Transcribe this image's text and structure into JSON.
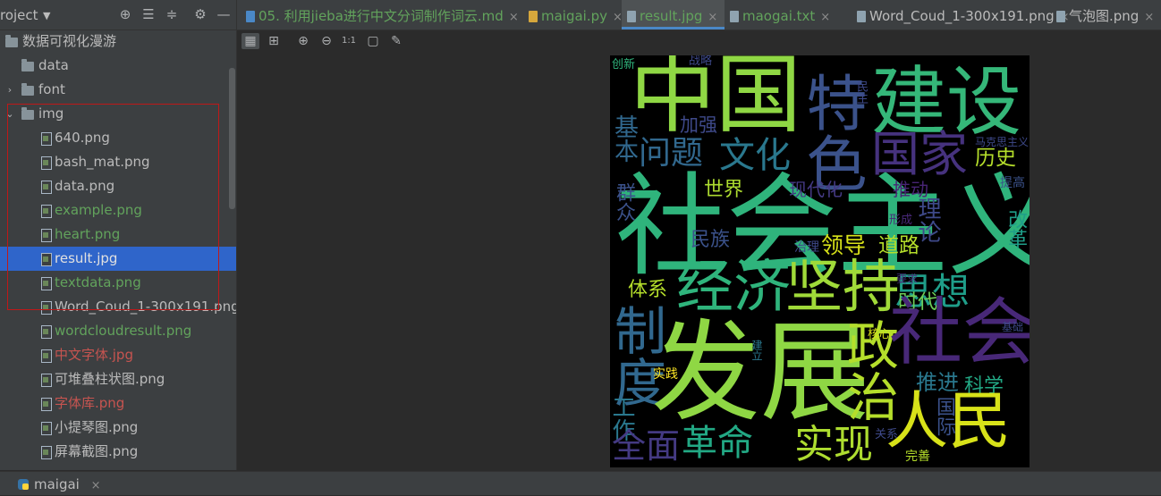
{
  "project": {
    "title": "roject",
    "header_icons": [
      "locate-icon",
      "collapse-all-icon",
      "expand-all-icon",
      "gear-icon",
      "hide-icon"
    ],
    "tree": [
      {
        "label": "数据可视化漫游",
        "type": "folder",
        "depth": 0,
        "arrow": "",
        "color": "default"
      },
      {
        "label": "data",
        "type": "folder",
        "depth": 1,
        "arrow": "",
        "color": "default"
      },
      {
        "label": "font",
        "type": "folder",
        "depth": 1,
        "arrow": "›",
        "color": "default"
      },
      {
        "label": "img",
        "type": "folder",
        "depth": 1,
        "arrow": "⌄",
        "color": "default"
      },
      {
        "label": "640.png",
        "type": "file",
        "depth": 2,
        "color": "default"
      },
      {
        "label": "bash_mat.png",
        "type": "file",
        "depth": 2,
        "color": "default"
      },
      {
        "label": "data.png",
        "type": "file",
        "depth": 2,
        "color": "default"
      },
      {
        "label": "example.png",
        "type": "file",
        "depth": 2,
        "color": "green"
      },
      {
        "label": "heart.png",
        "type": "file",
        "depth": 2,
        "color": "green"
      },
      {
        "label": "result.jpg",
        "type": "file",
        "depth": 2,
        "color": "white",
        "selected": true
      },
      {
        "label": "textdata.png",
        "type": "file",
        "depth": 2,
        "color": "green"
      },
      {
        "label": "Word_Coud_1-300x191.png",
        "type": "file",
        "depth": 2,
        "color": "default"
      },
      {
        "label": "wordcloudresult.png",
        "type": "file",
        "depth": 2,
        "color": "green"
      },
      {
        "label": "中文字体.jpg",
        "type": "file",
        "depth": 2,
        "color": "red"
      },
      {
        "label": "可堆叠柱状图.png",
        "type": "file",
        "depth": 2,
        "color": "default"
      },
      {
        "label": "字体库.png",
        "type": "file",
        "depth": 2,
        "color": "red"
      },
      {
        "label": "小提琴图.png",
        "type": "file",
        "depth": 2,
        "color": "default"
      },
      {
        "label": "屏幕截图.png",
        "type": "file",
        "depth": 2,
        "color": "default"
      }
    ]
  },
  "tabs": [
    {
      "label": "05. 利用jieba进行中文分词制作词云.md",
      "color": "#62a35c",
      "icon": "markdown-file-icon",
      "icon_color": "#4a88c7",
      "active": false
    },
    {
      "label": "maigai.py",
      "color": "#62a35c",
      "icon": "python-file-icon",
      "icon_color": "#d6a73c",
      "active": false
    },
    {
      "label": "result.jpg",
      "color": "#62a35c",
      "icon": "image-file-icon",
      "icon_color": "#8fa3b0",
      "active": true
    },
    {
      "label": "maogai.txt",
      "color": "#62a35c",
      "icon": "text-file-icon",
      "icon_color": "#8fa3b0",
      "active": false
    },
    {
      "label": "Word_Coud_1-300x191.png",
      "color": "#bbbbbb",
      "icon": "image-file-icon",
      "icon_color": "#8fa3b0",
      "active": false
    },
    {
      "label": "气泡图.png",
      "color": "#bbbbbb",
      "icon": "image-file-icon",
      "icon_color": "#8fa3b0",
      "active": false
    }
  ],
  "close_glyph": "×",
  "image_toolbar": {
    "buttons": [
      {
        "name": "chessboard-icon",
        "glyph": "▦",
        "on": true
      },
      {
        "name": "grid-icon",
        "glyph": "⊞",
        "on": false
      },
      {
        "name": "zoom-in-icon",
        "glyph": "⊕",
        "on": false
      },
      {
        "name": "zoom-out-icon",
        "glyph": "⊖",
        "on": false
      },
      {
        "name": "actual-size-icon",
        "glyph": "1:1",
        "on": false
      },
      {
        "name": "fit-icon",
        "glyph": "▢",
        "on": false
      },
      {
        "name": "color-picker-icon",
        "glyph": "✎",
        "on": false
      }
    ]
  },
  "wordcloud": {
    "words": [
      {
        "text": "中国",
        "color": "#8fd744",
        "v": false
      },
      {
        "text": "建设",
        "color": "#35b779",
        "v": false
      },
      {
        "text": "特色",
        "color": "#3b528b",
        "v": true
      },
      {
        "text": "社会主义",
        "color": "#2fb47c",
        "v": false
      },
      {
        "text": "国家",
        "color": "#46327e",
        "v": false
      },
      {
        "text": "问题",
        "color": "#31688e",
        "v": false
      },
      {
        "text": "文化",
        "color": "#2a788e",
        "v": false
      },
      {
        "text": "历史",
        "color": "#b5de2b",
        "v": false
      },
      {
        "text": "加强",
        "color": "#3e4989",
        "v": false
      },
      {
        "text": "基本",
        "color": "#31688e",
        "v": true
      },
      {
        "text": "群众",
        "color": "#3b528b",
        "v": true
      },
      {
        "text": "世界",
        "color": "#addc30",
        "v": false
      },
      {
        "text": "现代化",
        "color": "#443983",
        "v": false
      },
      {
        "text": "推动",
        "color": "#482475",
        "v": false
      },
      {
        "text": "理论",
        "color": "#3e4989",
        "v": true
      },
      {
        "text": "改革",
        "color": "#1f9e89",
        "v": true
      },
      {
        "text": "民族",
        "color": "#3b528b",
        "v": false
      },
      {
        "text": "领导",
        "color": "#d8e219",
        "v": false
      },
      {
        "text": "道路",
        "color": "#b5de2b",
        "v": false
      },
      {
        "text": "治理",
        "color": "#3e4989",
        "v": false
      },
      {
        "text": "形成",
        "color": "#482878",
        "v": false
      },
      {
        "text": "提高",
        "color": "#3b528b",
        "v": false
      },
      {
        "text": "体系",
        "color": "#b5de2b",
        "v": false
      },
      {
        "text": "经济",
        "color": "#2fb47c",
        "v": false
      },
      {
        "text": "坚持",
        "color": "#a0da39",
        "v": false
      },
      {
        "text": "思想",
        "color": "#1f9e89",
        "v": false
      },
      {
        "text": "时代",
        "color": "#6ece58",
        "v": false
      },
      {
        "text": "要求",
        "color": "#46337e",
        "v": false
      },
      {
        "text": "马克思主义",
        "color": "#3e4989",
        "v": false
      },
      {
        "text": "制度",
        "color": "#31688e",
        "v": true
      },
      {
        "text": "发展",
        "color": "#8fd744",
        "v": false
      },
      {
        "text": "政治",
        "color": "#b5de2b",
        "v": true
      },
      {
        "text": "社会",
        "color": "#482878",
        "v": false
      },
      {
        "text": "基础",
        "color": "#3e4989",
        "v": false
      },
      {
        "text": "核心",
        "color": "#d8e219",
        "v": false
      },
      {
        "text": "建立",
        "color": "#2a788e",
        "v": true
      },
      {
        "text": "推进",
        "color": "#2a788e",
        "v": false
      },
      {
        "text": "科学",
        "color": "#22a884",
        "v": false
      },
      {
        "text": "国际",
        "color": "#3b528b",
        "v": true
      },
      {
        "text": "实践",
        "color": "#fde725",
        "v": false
      },
      {
        "text": "工作",
        "color": "#2a788e",
        "v": true
      },
      {
        "text": "全面",
        "color": "#443a83",
        "v": false
      },
      {
        "text": "革命",
        "color": "#22a884",
        "v": false
      },
      {
        "text": "实现",
        "color": "#addc30",
        "v": false
      },
      {
        "text": "人民",
        "color": "#d8e219",
        "v": false
      },
      {
        "text": "关系",
        "color": "#3e4989",
        "v": false
      },
      {
        "text": "完善",
        "color": "#b5de2b",
        "v": false
      },
      {
        "text": "创新",
        "color": "#2fb47c",
        "v": false
      },
      {
        "text": "战略",
        "color": "#3e4989",
        "v": false
      },
      {
        "text": "民主",
        "color": "#3e4989",
        "v": true
      }
    ]
  },
  "bottom": {
    "run_label": "maigai",
    "close": "×"
  }
}
